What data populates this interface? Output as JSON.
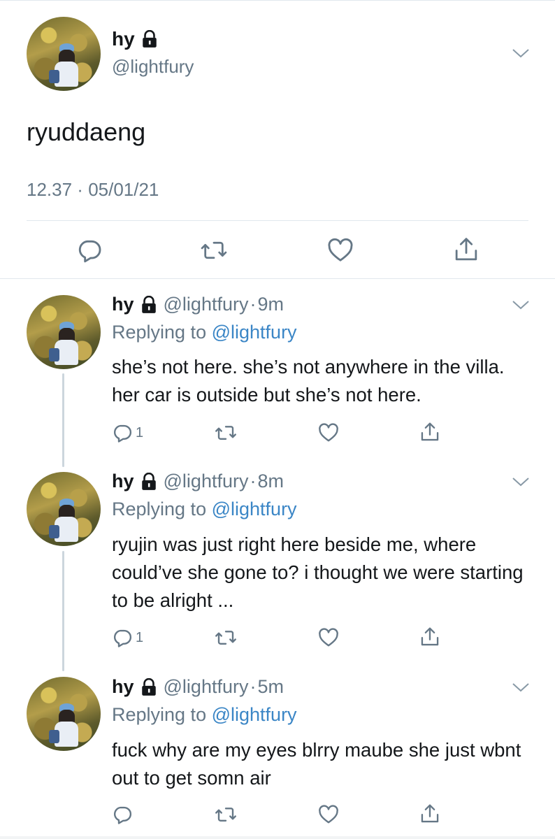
{
  "main_tweet": {
    "name": "hy",
    "handle": "@lightfury",
    "text": "ryuddaeng",
    "time": "12.37",
    "date": "05/01/21",
    "meta_separator": " · "
  },
  "replies": [
    {
      "name": "hy",
      "handle": "@lightfury",
      "dot": "·",
      "time": "9m",
      "replying_prefix": "Replying to",
      "replying_to": "@lightfury",
      "text": "she’s not here. she’s not anywhere in the villa. her car is outside but she’s not here.",
      "reply_count": "1"
    },
    {
      "name": "hy",
      "handle": "@lightfury",
      "dot": "·",
      "time": "8m",
      "replying_prefix": "Replying to",
      "replying_to": "@lightfury",
      "text": "ryujin was just right here beside me, where could’ve she gone to? i thought we were starting to be alright ...",
      "reply_count": "1"
    },
    {
      "name": "hy",
      "handle": "@lightfury",
      "dot": "·",
      "time": "5m",
      "replying_prefix": "Replying to",
      "replying_to": "@lightfury",
      "text": "fuck why are my eyes blrry maube she just wbnt out to get somn air",
      "reply_count": ""
    }
  ],
  "icons": {
    "reply": "reply-icon",
    "retweet": "retweet-icon",
    "like": "heart-icon",
    "share": "share-icon",
    "lock": "lock-icon",
    "more": "chevron-down-icon"
  },
  "colors": {
    "text": "#14171a",
    "secondary": "#657786",
    "link": "#3b86c6",
    "divider": "#e1e8ed",
    "thread_line": "#ccd6dd"
  }
}
